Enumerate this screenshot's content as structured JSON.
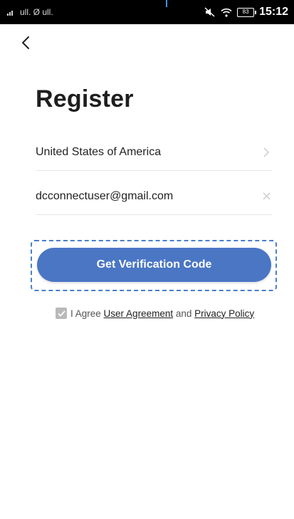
{
  "status_bar": {
    "left_text": "ull. Ø ull.",
    "battery": "83",
    "time": "15:12"
  },
  "page": {
    "title": "Register"
  },
  "form": {
    "country": "United States of America",
    "email_value": "dcconnectuser@gmail.com"
  },
  "actions": {
    "verify_label": "Get Verification Code"
  },
  "agreement": {
    "prefix": "I Agree",
    "user_agreement": "User Agreement",
    "and": "and",
    "privacy_policy": "Privacy Policy"
  },
  "colors": {
    "primary_button": "#4a76c4",
    "dashed_frame": "#4a7fc8",
    "checkbox": "#b9b9b9"
  },
  "icons": {
    "back": "chevron-left-icon",
    "country_arrow": "chevron-right-icon",
    "clear": "close-icon",
    "check": "check-icon"
  }
}
